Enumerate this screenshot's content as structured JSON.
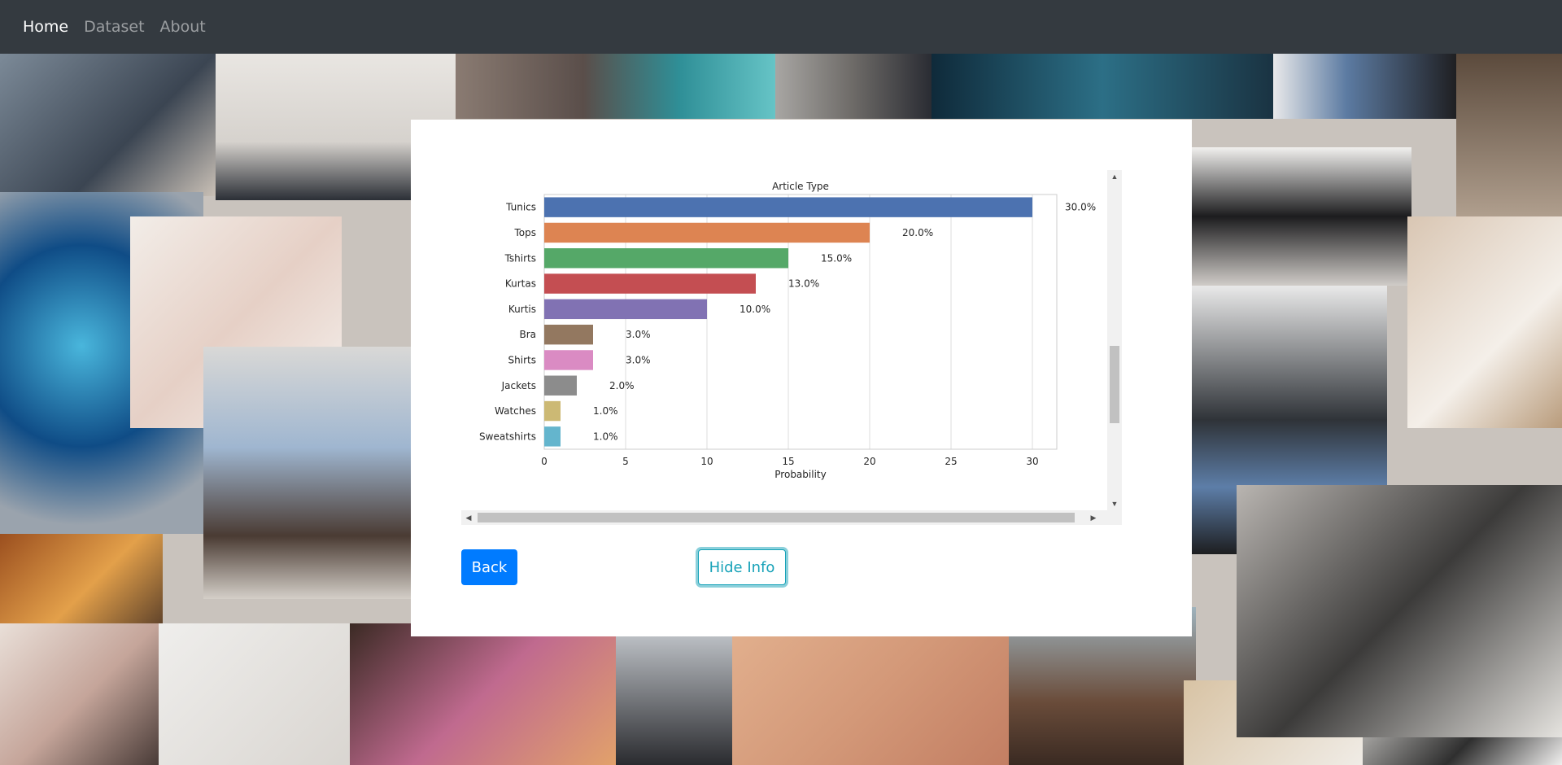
{
  "nav": {
    "items": [
      {
        "label": "Home",
        "active": true
      },
      {
        "label": "Dataset",
        "active": false
      },
      {
        "label": "About",
        "active": false
      }
    ]
  },
  "buttons": {
    "back_label": "Back",
    "hide_info_label": "Hide Info"
  },
  "scrollbar_icons": {
    "up": "▲",
    "down": "▼",
    "left": "◀",
    "right": "▶"
  },
  "colors": {
    "navbar": "#343a40",
    "primary": "#007bff",
    "info": "#17a2b8"
  },
  "chart_data": {
    "type": "bar",
    "orientation": "horizontal",
    "title": "Article Type",
    "xlabel": "Probability",
    "ylabel": "",
    "xlim": [
      0,
      31.5
    ],
    "xticks": [
      0,
      5,
      10,
      15,
      20,
      25,
      30
    ],
    "grid": true,
    "categories": [
      "Tunics",
      "Tops",
      "Tshirts",
      "Kurtas",
      "Kurtis",
      "Bra",
      "Shirts",
      "Jackets",
      "Watches",
      "Sweatshirts"
    ],
    "values": [
      30,
      20,
      15,
      13,
      10,
      3,
      3,
      2,
      1,
      1
    ],
    "data_labels": [
      "30.0%",
      "20.0%",
      "15.0%",
      "13.0%",
      "10.0%",
      "3.0%",
      "3.0%",
      "2.0%",
      "1.0%",
      "1.0%"
    ],
    "colors": [
      "#4c72b0",
      "#dd8452",
      "#55a868",
      "#c44e52",
      "#8172b3",
      "#937860",
      "#da8bc3",
      "#8c8c8c",
      "#ccb974",
      "#64b5cd"
    ]
  }
}
